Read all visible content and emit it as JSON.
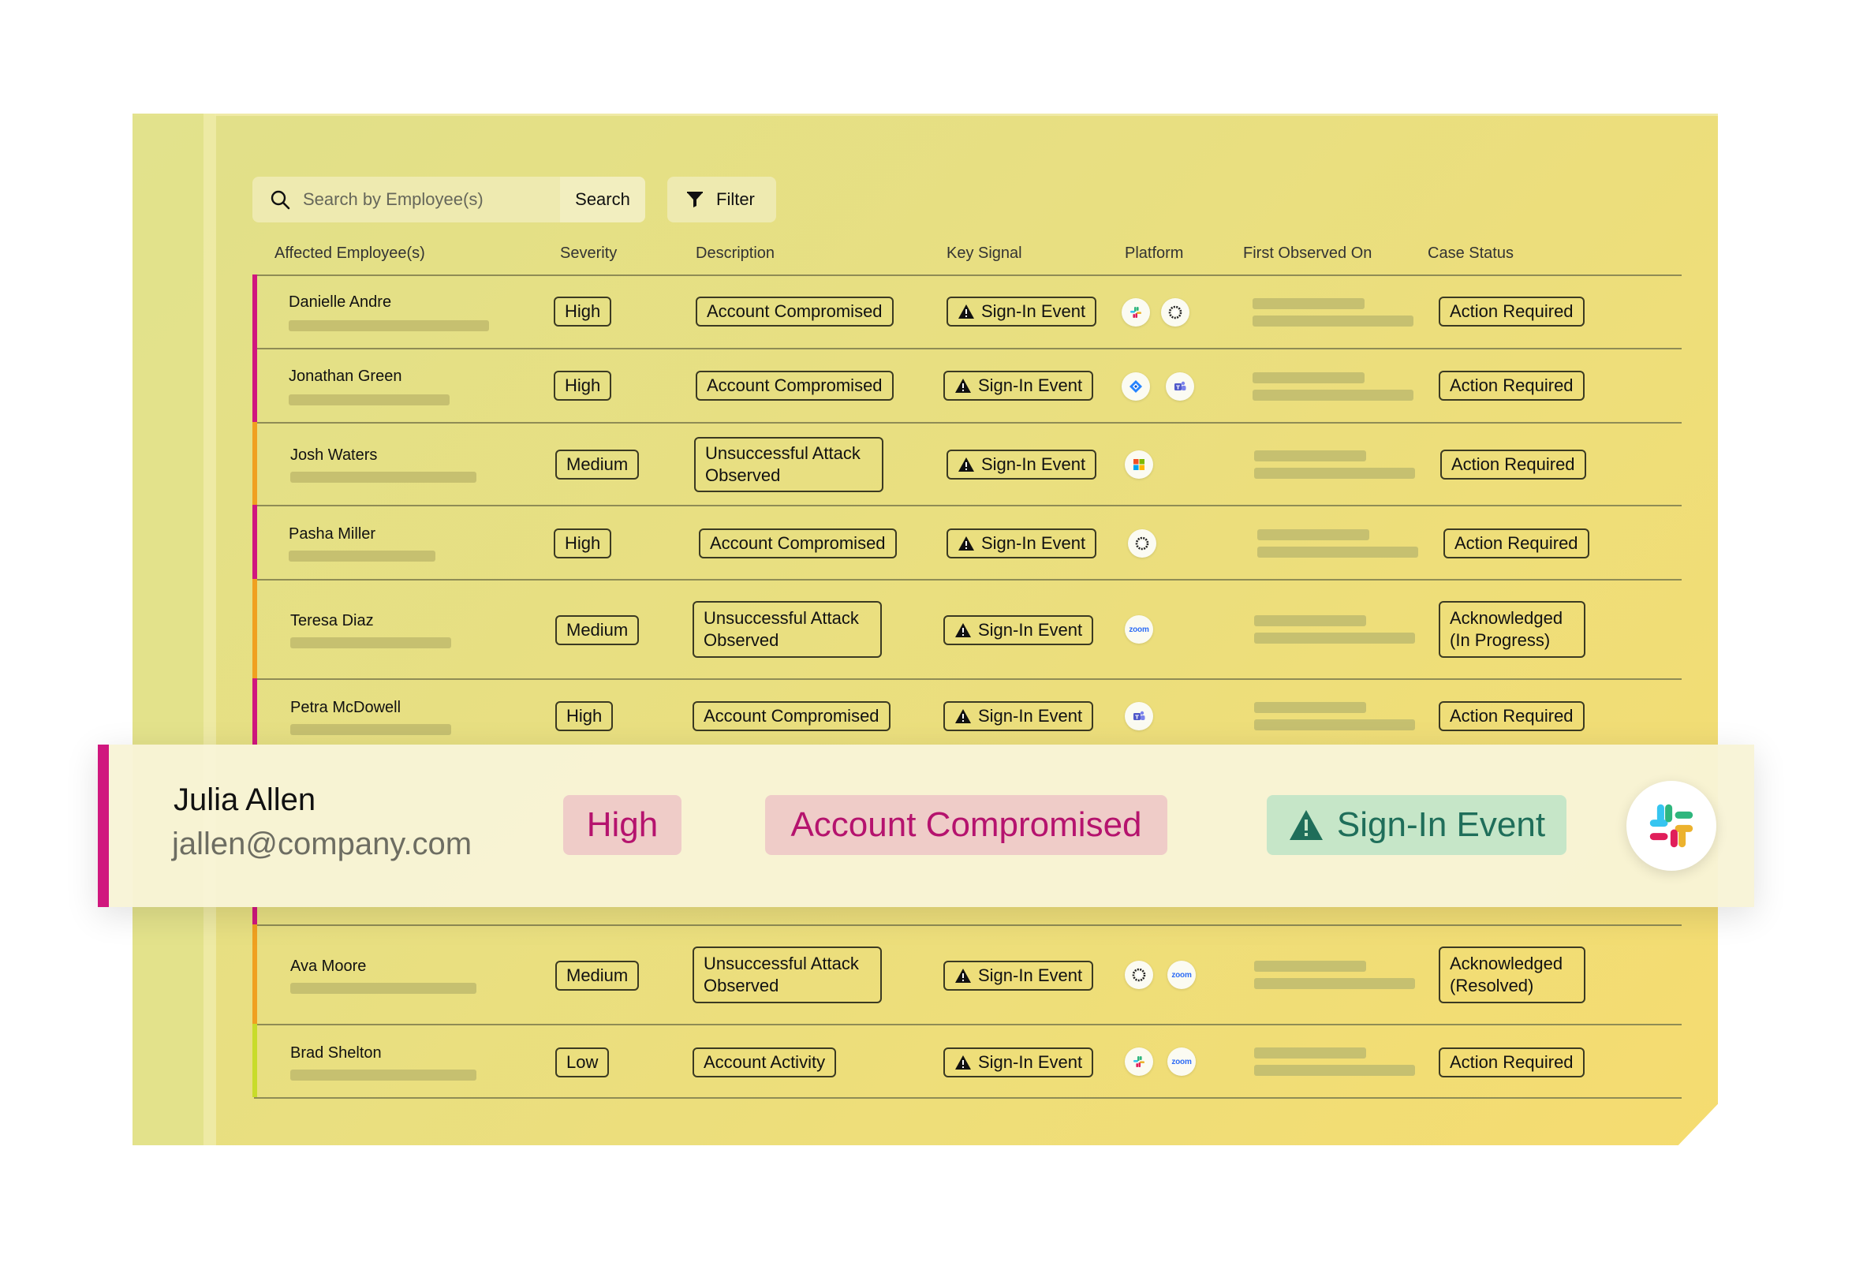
{
  "toolbar": {
    "search_placeholder": "Search by Employee(s)",
    "search_button": "Search",
    "filter_button": "Filter"
  },
  "columns": [
    "Affected Employee(s)",
    "Severity",
    "Description",
    "Key Signal",
    "Platform",
    "First Observed On",
    "Case Status"
  ],
  "colors": {
    "high": "#d0177e",
    "medium": "#f0a020",
    "low": "#c8dc2a",
    "panel": "#e6e08a"
  },
  "rows": [
    {
      "name": "Danielle Andre",
      "severity": "High",
      "description": "Account Compromised",
      "key_signal": "Sign-In Event",
      "platforms": [
        "slack-icon",
        "okta-icon"
      ],
      "status": "Action Required"
    },
    {
      "name": "Jonathan Green",
      "severity": "High",
      "description": "Account Compromised",
      "key_signal": "Sign-In Event",
      "platforms": [
        "jira-icon",
        "teams-icon"
      ],
      "status": "Action Required"
    },
    {
      "name": "Josh Waters",
      "severity": "Medium",
      "description": "Unsuccessful Attack Observed",
      "key_signal": "Sign-In Event",
      "platforms": [
        "microsoft-icon"
      ],
      "status": "Action Required"
    },
    {
      "name": "Pasha Miller",
      "severity": "High",
      "description": "Account Compromised",
      "key_signal": "Sign-In Event",
      "platforms": [
        "okta-icon"
      ],
      "status": "Action Required"
    },
    {
      "name": "Teresa Diaz",
      "severity": "Medium",
      "description": "Unsuccessful Attack Observed",
      "key_signal": "Sign-In Event",
      "platforms": [
        "zoom-icon"
      ],
      "status": "Acknowledged (In Progress)"
    },
    {
      "name": "Petra McDowell",
      "severity": "High",
      "description": "Account Compromised",
      "key_signal": "Sign-In Event",
      "platforms": [
        "teams-icon"
      ],
      "status": "Action Required"
    },
    {
      "name": "Ava Moore",
      "severity": "Medium",
      "description": "Unsuccessful Attack Observed",
      "key_signal": "Sign-In Event",
      "platforms": [
        "okta-icon",
        "zoom-icon"
      ],
      "status": "Acknowledged (Resolved)"
    },
    {
      "name": "Brad Shelton",
      "severity": "Low",
      "description": "Account Activity",
      "key_signal": "Sign-In Event",
      "platforms": [
        "slack-icon",
        "zoom-icon"
      ],
      "status": "Action Required"
    }
  ],
  "zoom_label": "zoom",
  "highlight": {
    "name": "Julia Allen",
    "email": "jallen@company.com",
    "severity": "High",
    "description": "Account Compromised",
    "key_signal": "Sign-In Event",
    "platform": "slack-icon"
  }
}
